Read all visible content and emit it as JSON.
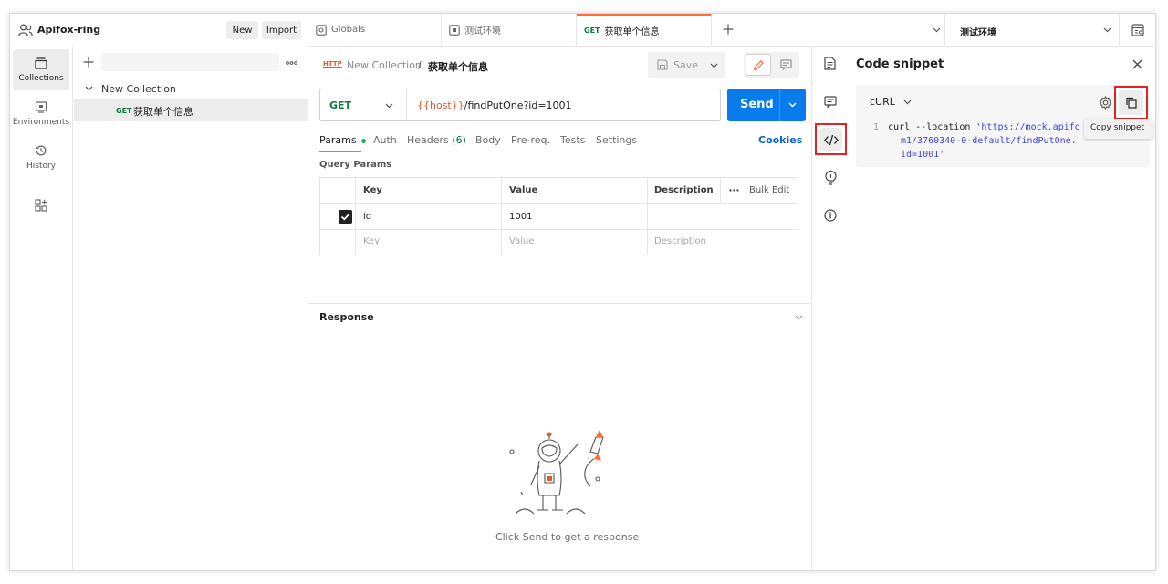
{
  "workspace": {
    "name": "Apifox-ring",
    "new_label": "New",
    "import_label": "Import"
  },
  "rail": {
    "collections": "Collections",
    "environments": "Environments",
    "history": "History"
  },
  "tree": {
    "collection": "New Collection",
    "request_method": "GET",
    "request_name": "获取单个信息"
  },
  "tabs": [
    {
      "label": "Globals"
    },
    {
      "label": "测试环境"
    },
    {
      "method": "GET",
      "label": "获取单个信息"
    }
  ],
  "environment": {
    "selected": "测试环境"
  },
  "breadcrumb": {
    "badge": "HTTP",
    "collection": "New Collection",
    "separator": "/",
    "request": "获取单个信息"
  },
  "toolbar": {
    "save_label": "Save"
  },
  "request": {
    "method": "GET",
    "url_var": "{{host}}",
    "url_path": "/findPutOne?id=1001",
    "send_label": "Send"
  },
  "req_tabs": {
    "params": "Params",
    "auth": "Auth",
    "headers": "Headers",
    "headers_count": "(6)",
    "body": "Body",
    "prereq": "Pre-req.",
    "tests": "Tests",
    "settings": "Settings",
    "cookies": "Cookies"
  },
  "query": {
    "title": "Query Params",
    "columns": {
      "key": "Key",
      "value": "Value",
      "description": "Description",
      "bulk": "Bulk Edit"
    },
    "rows": [
      {
        "key": "id",
        "value": "1001",
        "checked": true
      }
    ],
    "placeholder": {
      "key": "Key",
      "value": "Value",
      "description": "Description"
    }
  },
  "response": {
    "title": "Response",
    "hint": "Click Send to get a response"
  },
  "snippet": {
    "title": "Code snippet",
    "language": "cURL",
    "line_no": "1",
    "code_plain": "curl --location ",
    "code_str_1": "'https://mock.apifo",
    "code_str_2": "m1/3760340-0-default/findPutOne.",
    "code_str_3": "id=1001'",
    "tooltip": "Copy snippet"
  },
  "colors": {
    "accent": "#ff6c37",
    "send": "#097bed",
    "cookies": "#0265d2",
    "highlight": "#e02424",
    "var": "#e05a2b"
  }
}
